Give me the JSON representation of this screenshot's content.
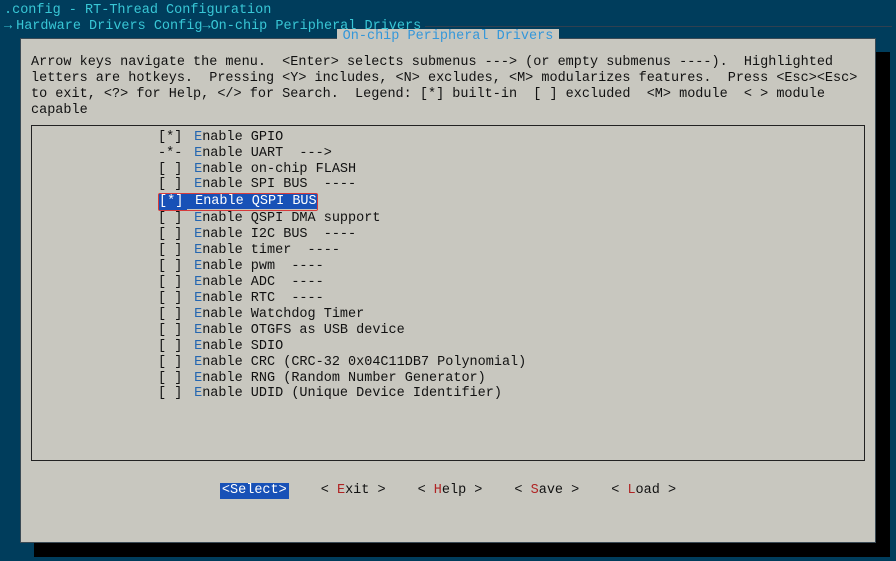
{
  "title": ".config - RT-Thread Configuration",
  "breadcrumb_arrow": "→",
  "breadcrumb_a": "Hardware Drivers Config",
  "breadcrumb_sep": " → ",
  "breadcrumb_b": "On-chip Peripheral Drivers",
  "panel_title": "On-chip Peripheral Drivers",
  "help_text": "Arrow keys navigate the menu.  <Enter> selects submenus ---> (or empty submenus ----).  Highlighted\nletters are hotkeys.  Pressing <Y> includes, <N> excludes, <M> modularizes features.  Press <Esc><Esc>\nto exit, <?> for Help, </> for Search.  Legend: [*] built-in  [ ] excluded  <M> module  < > module\ncapable",
  "items": [
    {
      "mark": "[*]",
      "hot": "E",
      "rest": "nable GPIO",
      "suffix": "",
      "selected": false
    },
    {
      "mark": "-*-",
      "hot": "E",
      "rest": "nable UART",
      "suffix": "  --->",
      "selected": false
    },
    {
      "mark": "[ ]",
      "hot": "E",
      "rest": "nable on-chip FLASH",
      "suffix": "",
      "selected": false
    },
    {
      "mark": "[ ]",
      "hot": "E",
      "rest": "nable SPI BUS",
      "suffix": "  ----",
      "selected": false
    },
    {
      "mark": "[*]",
      "hot": "E",
      "rest": "nable QSPI BUS",
      "suffix": "",
      "selected": true
    },
    {
      "mark": "[ ]",
      "hot": "E",
      "rest": "nable QSPI DMA support",
      "suffix": "",
      "selected": false
    },
    {
      "mark": "[ ]",
      "hot": "E",
      "rest": "nable I2C BUS",
      "suffix": "  ----",
      "selected": false
    },
    {
      "mark": "[ ]",
      "hot": "E",
      "rest": "nable timer",
      "suffix": "  ----",
      "selected": false
    },
    {
      "mark": "[ ]",
      "hot": "E",
      "rest": "nable pwm",
      "suffix": "  ----",
      "selected": false
    },
    {
      "mark": "[ ]",
      "hot": "E",
      "rest": "nable ADC",
      "suffix": "  ----",
      "selected": false
    },
    {
      "mark": "[ ]",
      "hot": "E",
      "rest": "nable RTC",
      "suffix": "  ----",
      "selected": false
    },
    {
      "mark": "[ ]",
      "hot": "E",
      "rest": "nable Watchdog Timer",
      "suffix": "",
      "selected": false
    },
    {
      "mark": "[ ]",
      "hot": "E",
      "rest": "nable OTGFS as USB device",
      "suffix": "",
      "selected": false
    },
    {
      "mark": "[ ]",
      "hot": "E",
      "rest": "nable SDIO",
      "suffix": "",
      "selected": false
    },
    {
      "mark": "[ ]",
      "hot": "E",
      "rest": "nable CRC (CRC-32 0x04C11DB7 Polynomial)",
      "suffix": "",
      "selected": false
    },
    {
      "mark": "[ ]",
      "hot": "E",
      "rest": "nable RNG (Random Number Generator)",
      "suffix": "",
      "selected": false
    },
    {
      "mark": "[ ]",
      "hot": "E",
      "rest": "nable UDID (Unique Device Identifier)",
      "suffix": "",
      "selected": false
    }
  ],
  "buttons": {
    "select_open": "<",
    "select_label": "Select",
    "select_close": ">",
    "exit_hot": "E",
    "exit_rest": "xit",
    "help_hot": "H",
    "help_rest": "elp",
    "save_hot": "S",
    "save_rest": "ave",
    "load_hot": "L",
    "load_rest": "oad"
  }
}
